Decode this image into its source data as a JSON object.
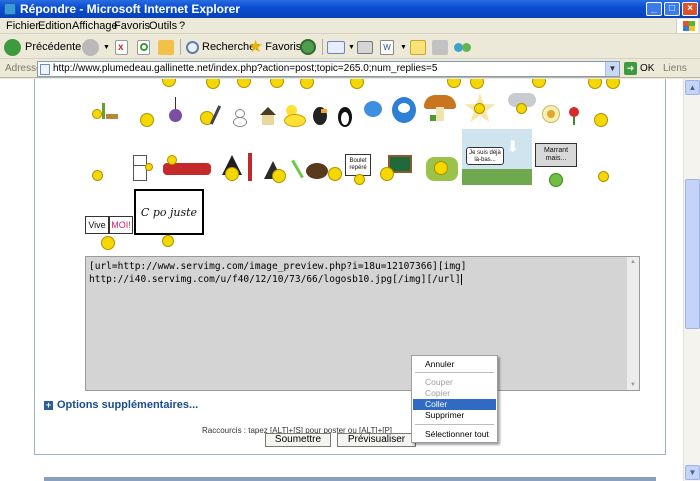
{
  "window": {
    "title": "Répondre - Microsoft Internet Explorer",
    "buttons": {
      "minimize": "_",
      "maximize": "□",
      "close": "×"
    }
  },
  "menu": [
    "Fichier",
    "Edition",
    "Affichage",
    "Favoris",
    "Outils",
    "?"
  ],
  "toolbar": {
    "back_label": "Précédente",
    "search_label": "Rechercher",
    "favorites_label": "Favoris"
  },
  "address": {
    "label": "Adresse",
    "url": "http://www.plumedeau.gallinette.net/index.php?action=post;topic=265.0;num_replies=5",
    "go_label": "OK",
    "links_label": "Liens"
  },
  "emoticons": {
    "sign_vive": "Vive",
    "sign_moi": "MOI!",
    "sign_cpojuste": "C po juste",
    "sign_boulet": "Boulet repéré",
    "sign_jesuisdeja": "Je suis déjà là-bas...",
    "sign_marrant": "Marrant mais..."
  },
  "post": {
    "message_line1": "[url=http://www.servimg.com/image_preview.php?i=18u=12107366][img]",
    "message_line2": "http://i40.servimg.com/u/f40/12/10/73/66/logosb10.jpg[/img][/url]",
    "options_label": "Options supplémentaires...",
    "shortcuts_text": "Raccourcis : tapez [ALT]+[S] pour poster ou [ALT]+[P]",
    "submit_label": "Soumettre",
    "preview_label": "Prévisualiser"
  },
  "context_menu": {
    "undo": "Annuler",
    "cut": "Couper",
    "copy": "Copier",
    "paste": "Coller",
    "delete": "Supprimer",
    "select_all": "Sélectionner tout"
  },
  "colors": {
    "titlebar": "#0a4fd3",
    "highlight": "#316ac5",
    "textarea_bg": "#d4d4d4",
    "link": "#1a4c8c"
  }
}
